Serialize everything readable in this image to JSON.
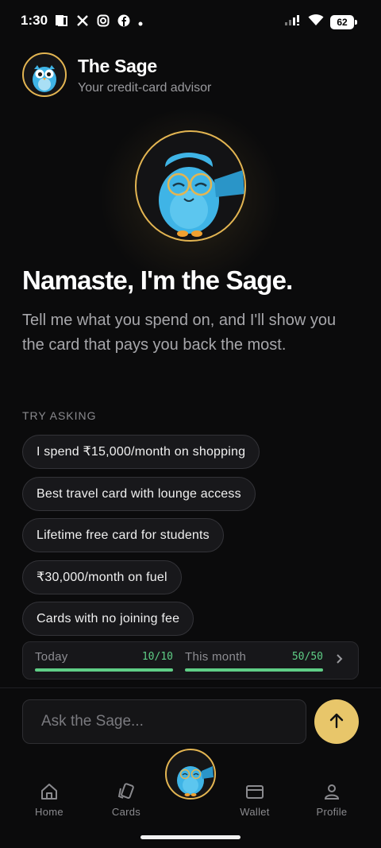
{
  "status_bar": {
    "time": "1:30",
    "battery": "62",
    "left_icons": [
      "notification-icon",
      "x-icon",
      "instagram-icon",
      "facebook-icon",
      "dot-icon"
    ],
    "right_icons": [
      "signal-icon",
      "wifi-icon",
      "battery-icon"
    ]
  },
  "header": {
    "title": "The Sage",
    "subtitle": "Your credit-card advisor",
    "avatar_icon": "owl-mascot-icon"
  },
  "hero": {
    "avatar_icon": "owl-mascot-waving-icon",
    "greeting": "Namaste, I'm the Sage.",
    "intro": "Tell me what you spend on, and I'll show you the card that pays you back the most."
  },
  "suggestions": {
    "label": "TRY ASKING",
    "items": [
      "I spend ₹15,000/month on shopping",
      "Best travel card with lounge access",
      "Lifetime free card for students",
      "₹30,000/month on fuel",
      "Cards with no joining fee"
    ]
  },
  "usage": {
    "today": {
      "label": "Today",
      "count": "10/10",
      "fraction": 1.0
    },
    "month": {
      "label": "This month",
      "count": "50/50",
      "fraction": 1.0
    },
    "chevron_icon": "chevron-right-icon"
  },
  "composer": {
    "placeholder": "Ask the Sage...",
    "send_icon": "arrow-up-icon"
  },
  "nav": {
    "items": [
      {
        "label": "Home",
        "icon": "home-icon"
      },
      {
        "label": "Cards",
        "icon": "cards-icon"
      },
      {
        "label": "Wallet",
        "icon": "wallet-icon"
      },
      {
        "label": "Profile",
        "icon": "profile-icon"
      }
    ],
    "center_icon": "owl-mascot-icon"
  },
  "colors": {
    "background": "#0b0b0c",
    "accent_gold": "#e3b552",
    "send_button": "#e8c66a",
    "progress_green": "#5fce86",
    "owl_blue": "#3fb4e6"
  }
}
